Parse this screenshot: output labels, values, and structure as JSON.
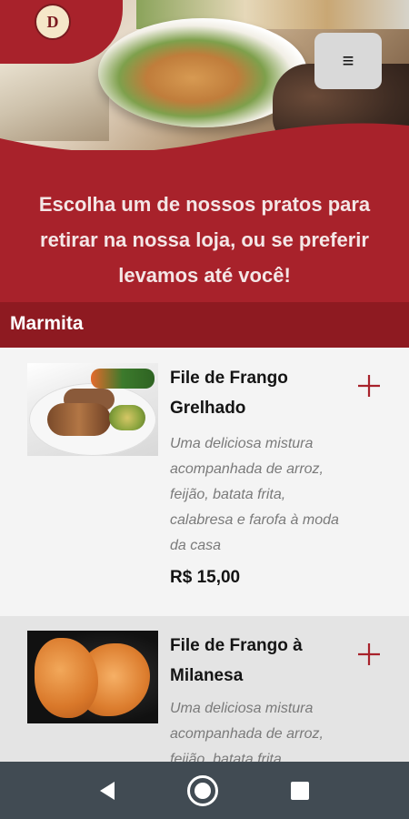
{
  "header": {
    "logo_letter": "D",
    "menu_icon": "hamburger-icon",
    "menu_glyph": "≡"
  },
  "banner": {
    "headline": "Escolha um de nossos pratos para retirar na nossa loja, ou se preferir levamos até você!"
  },
  "section": {
    "title": "Marmita"
  },
  "products": [
    {
      "name": "File de Frango Grelhado",
      "description": "Uma deliciosa mistura acompanhada de arroz, feijão, batata frita, calabresa e farofa à moda da casa",
      "price": "R$ 15,00",
      "image_icon": "grilled-chicken-plate"
    },
    {
      "name": "File de Frango à Milanesa",
      "description": "Uma deliciosa mistura acompanhada de arroz, feijão, batata frita, calabresa e farofa à moda da casa",
      "image_icon": "breaded-chicken-plate"
    }
  ],
  "navbar": {
    "back_icon": "back-triangle-icon",
    "home_icon": "home-circle-icon",
    "recent_icon": "recent-square-icon"
  },
  "colors": {
    "brand_red": "#a8222b",
    "section_red": "#8e1a21",
    "add_red": "#a8222b",
    "navbar": "#414b53"
  }
}
